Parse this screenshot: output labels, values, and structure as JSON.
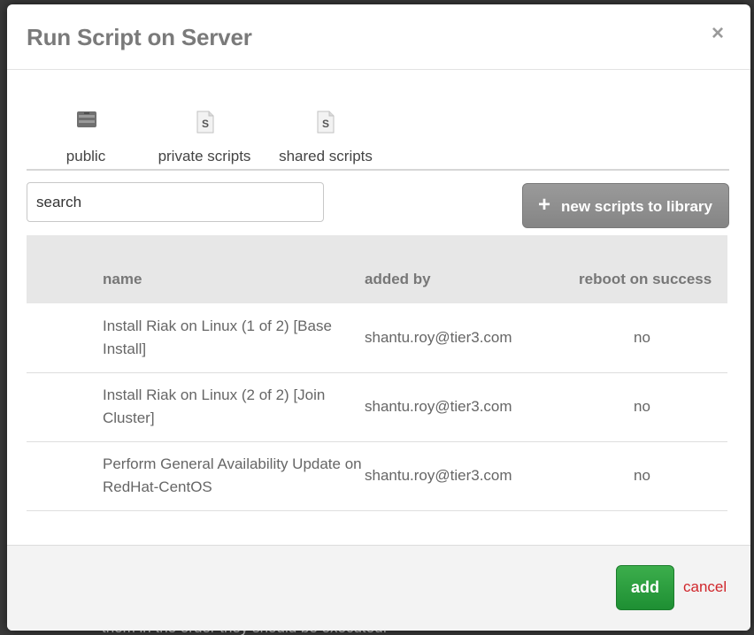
{
  "background": {
    "text": "them in the order they should be executed."
  },
  "modal": {
    "title": "Run Script on Server",
    "close_icon": "×"
  },
  "tabs": [
    {
      "label": "public",
      "icon": "server-icon"
    },
    {
      "label": "private scripts",
      "icon": "script-file-icon"
    },
    {
      "label": "shared scripts",
      "icon": "script-file-icon"
    }
  ],
  "search": {
    "value": "search",
    "placeholder": "search"
  },
  "toolbar": {
    "new_script_label": "new scripts to library",
    "new_script_icon": "+"
  },
  "table": {
    "headers": {
      "name": "name",
      "added_by": "added by",
      "reboot": "reboot on success"
    },
    "rows": [
      {
        "name": "Install Riak on Linux (1 of 2) [Base Install]",
        "added_by": "shantu.roy@tier3.com",
        "reboot": "no"
      },
      {
        "name": "Install Riak on Linux (2 of 2) [Join Cluster]",
        "added_by": "shantu.roy@tier3.com",
        "reboot": "no"
      },
      {
        "name": "Perform General Availability Update on RedHat-CentOS",
        "added_by": "shantu.roy@tier3.com",
        "reboot": "no"
      }
    ]
  },
  "footer": {
    "add_label": "add",
    "cancel_label": "cancel"
  },
  "colors": {
    "accent_green": "#2a9c3e",
    "cancel_red": "#d0262b",
    "title_gray": "#7a7a7a"
  }
}
